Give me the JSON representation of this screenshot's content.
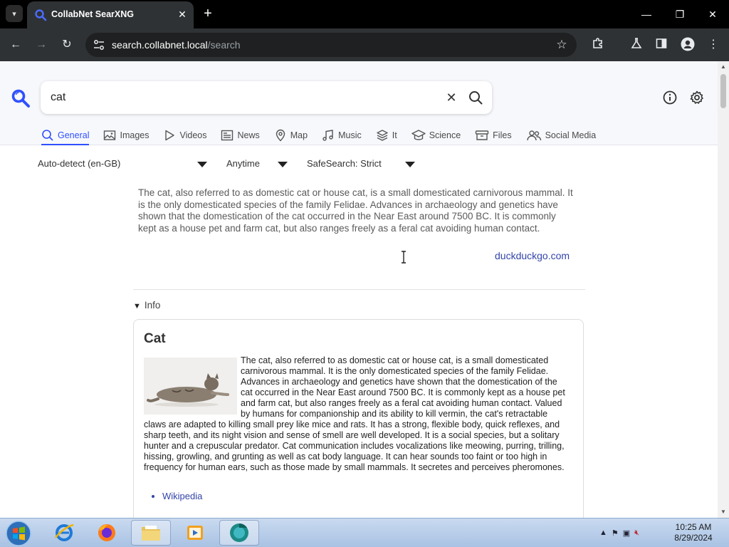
{
  "browser": {
    "tab_title": "CollabNet SearXNG",
    "url_host": "search.collabnet.local",
    "url_path": "/search"
  },
  "search": {
    "query": "cat"
  },
  "categories": [
    {
      "label": "General",
      "icon": "search-icon",
      "active": true
    },
    {
      "label": "Images",
      "icon": "image-icon"
    },
    {
      "label": "Videos",
      "icon": "play-icon"
    },
    {
      "label": "News",
      "icon": "newspaper-icon"
    },
    {
      "label": "Map",
      "icon": "map-pin-icon"
    },
    {
      "label": "Music",
      "icon": "music-icon"
    },
    {
      "label": "It",
      "icon": "layers-icon"
    },
    {
      "label": "Science",
      "icon": "school-icon"
    },
    {
      "label": "Files",
      "icon": "archive-icon"
    },
    {
      "label": "Social Media",
      "icon": "people-icon"
    }
  ],
  "filters": {
    "language": "Auto-detect (en-GB)",
    "time": "Anytime",
    "safesearch": "SafeSearch: Strict"
  },
  "answer": {
    "text": "The cat, also referred to as domestic cat or house cat, is a small domesticated carnivorous mammal. It is the only domesticated species of the family Felidae. Advances in archaeology and genetics have shown that the domestication of the cat occurred in the Near East around 7500 BC. It is commonly kept as a house pet and farm cat, but also ranges freely as a feral cat avoiding human contact.",
    "source": "duckduckgo.com"
  },
  "infobox": {
    "toggle_label": "Info",
    "title": "Cat",
    "content": "The cat, also referred to as domestic cat or house cat, is a small domesticated carnivorous mammal. It is the only domesticated species of the family Felidae. Advances in archaeology and genetics have shown that the domestication of the cat occurred in the Near East around 7500 BC. It is commonly kept as a house pet and farm cat, but also ranges freely as a feral cat avoiding human contact. Valued by humans for companionship and its ability to kill vermin, the cat's retractable claws are adapted to killing small prey like mice and rats. It has a strong, flexible body, quick reflexes, and sharp teeth, and its night vision and sense of smell are well developed. It is a social species, but a solitary hunter and a crepuscular predator. Cat communication includes vocalizations like meowing, purring, trilling, hissing, growling, and grunting as well as cat body language. It can hear sounds too faint or too high in frequency for human ears, such as those made by small mammals. It secretes and perceives pheromones.",
    "links": [
      "Wikipedia"
    ]
  },
  "taskbar": {
    "time": "10:25 AM",
    "date": "8/29/2024"
  },
  "colors": {
    "accent": "#3050ff",
    "link": "#3344aa"
  }
}
